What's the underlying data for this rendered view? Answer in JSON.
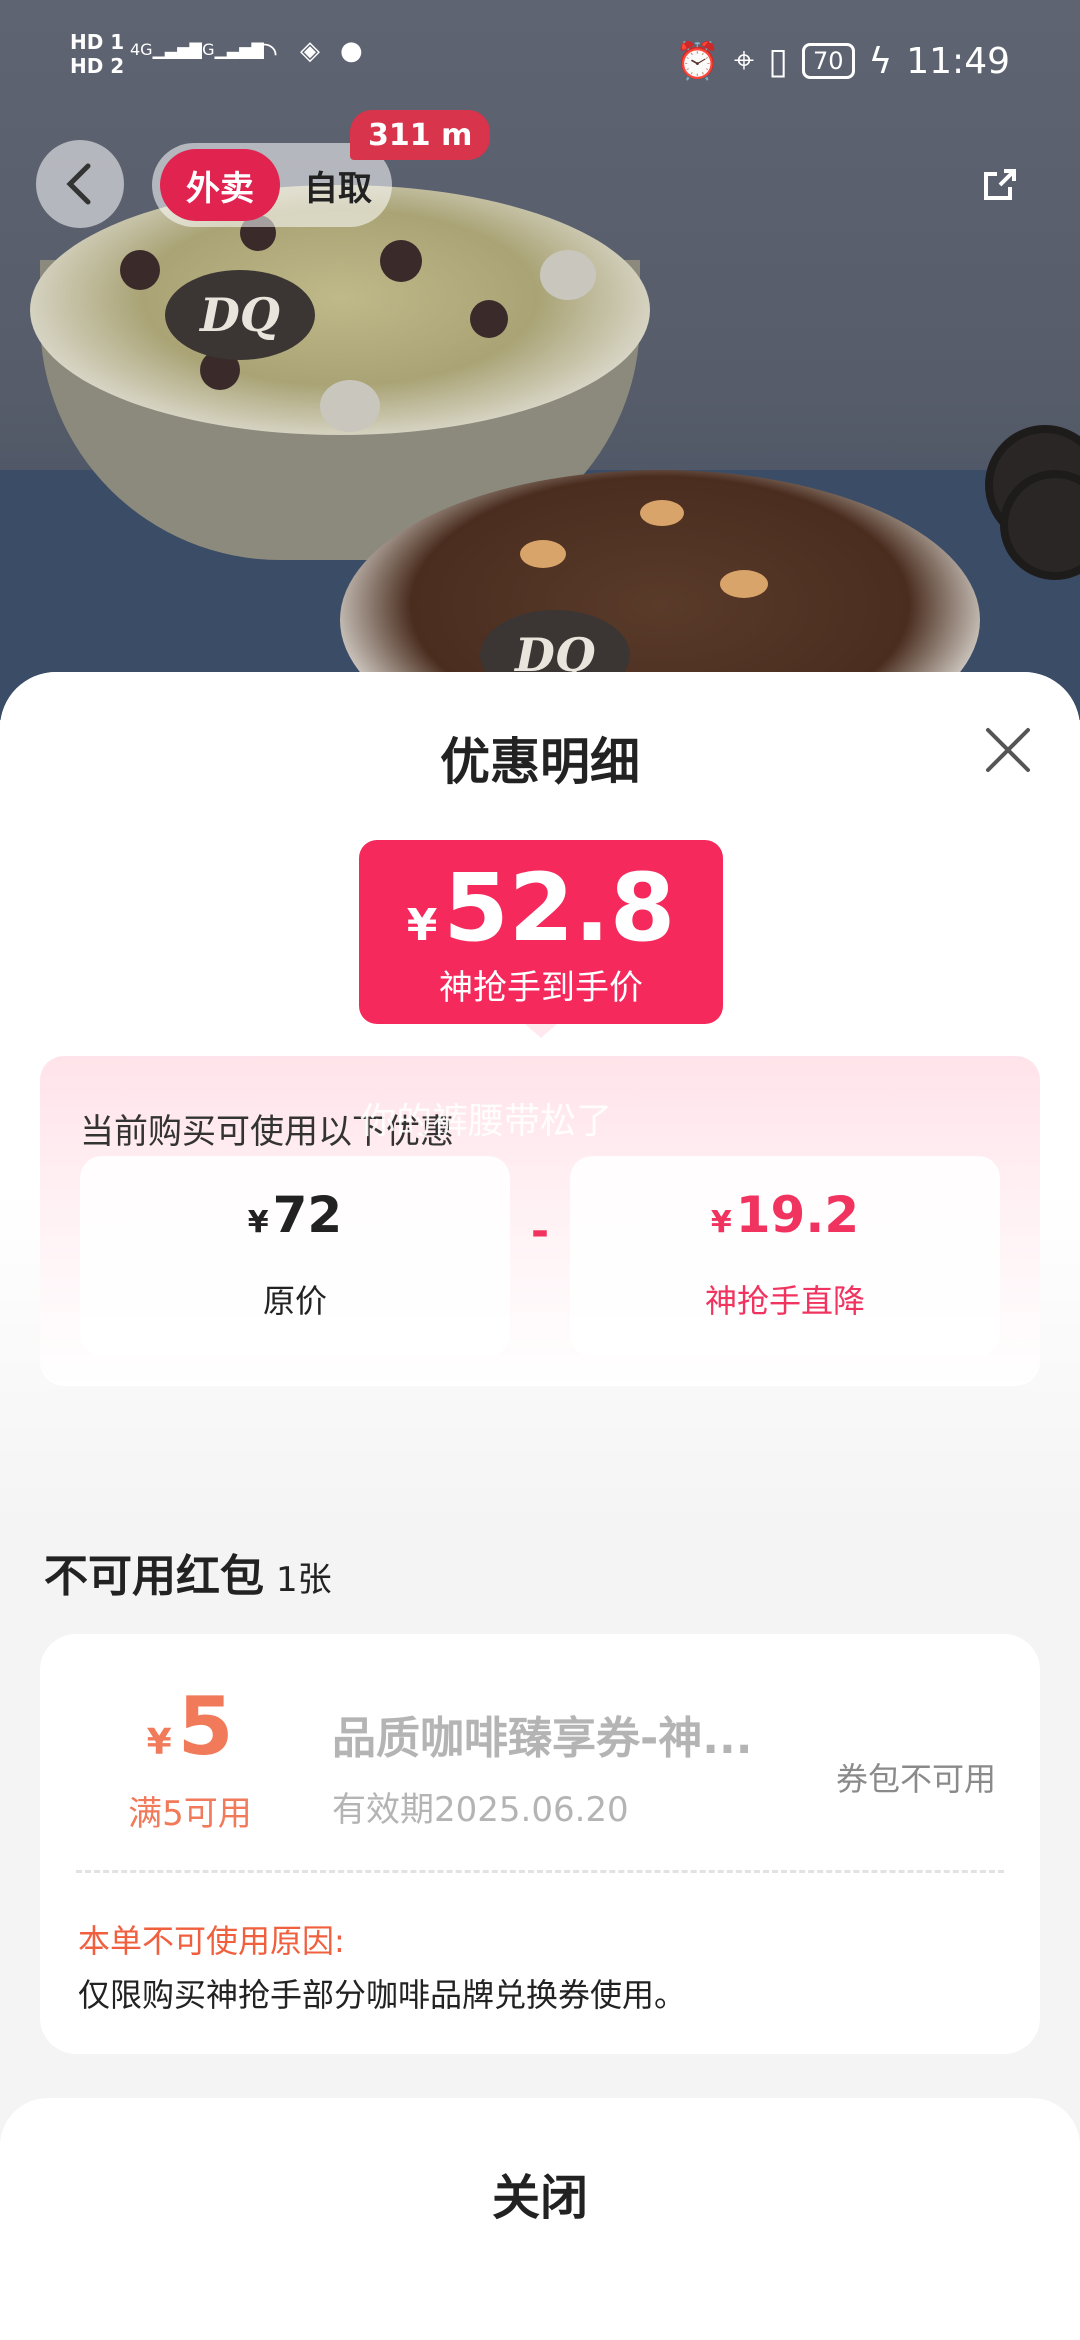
{
  "status_bar": {
    "sim1": "HD 1",
    "sim2": "HD 2",
    "net1": "4G",
    "net2": "5G",
    "battery": "70",
    "time": "11:49"
  },
  "header": {
    "tab_delivery": "外卖",
    "tab_pickup": "自取",
    "distance": "311 m"
  },
  "hero": {
    "logo_text": "DQ"
  },
  "sheet": {
    "title": "优惠明细",
    "price": {
      "currency": "¥",
      "amount": "52.8",
      "label": "神抢手到手价"
    },
    "promo": {
      "heading": "当前购买可使用以下优惠",
      "watermark": "你的裤腰带松了",
      "original": {
        "currency": "¥",
        "amount": "72",
        "label": "原价"
      },
      "operator": "-",
      "discount": {
        "currency": "¥",
        "amount": "19.2",
        "label": "神抢手直降"
      }
    },
    "unavailable": {
      "heading": "不可用红包",
      "count": "1张",
      "coupon": {
        "currency": "¥",
        "amount": "5",
        "condition": "满5可用",
        "title": "品质咖啡臻享券-神...",
        "expiry": "有效期2025.06.20",
        "status": "券包不可用",
        "reason_title": "本单不可使用原因:",
        "reason": "仅限购买神抢手部分咖啡品牌兑换券使用。"
      }
    },
    "close_label": "关闭"
  },
  "colors": {
    "accent": "#f5295c",
    "coupon": "#f07a5a",
    "reason": "#f0603e"
  },
  "icons": [
    "back-arrow-icon",
    "share-icon",
    "close-icon",
    "alarm-icon",
    "location-icon",
    "vibrate-icon",
    "charging-icon",
    "wifi-icon",
    "wechat-icon"
  ]
}
